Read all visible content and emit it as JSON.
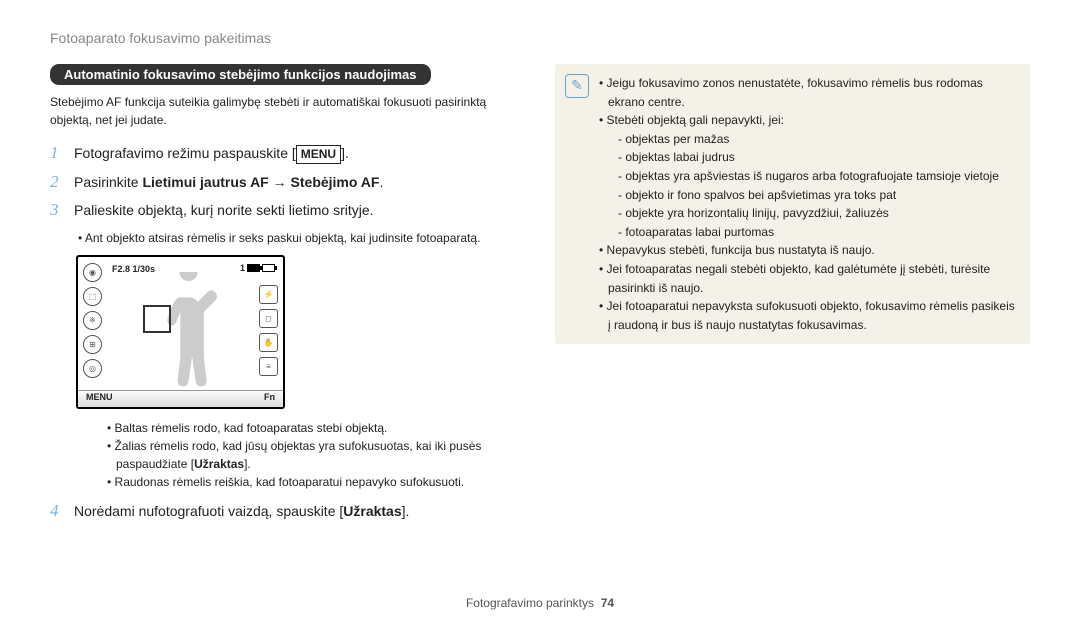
{
  "header": "Fotoaparato fokusavimo pakeitimas",
  "section_title": "Automatinio fokusavimo stebėjimo funkcijos naudojimas",
  "intro": "Stebėjimo AF funkcija suteikia galimybę stebėti ir automatiškai fokusuoti pasirinktą objektą, net jei judate.",
  "steps": {
    "s1": {
      "num": "1",
      "pre": "Fotografavimo režimu paspauskite [",
      "menu": "MENU",
      "post": "]."
    },
    "s2": {
      "num": "2",
      "pre": "Pasirinkite ",
      "b1": "Lietimui jautrus AF",
      "arrow": " → ",
      "b2": "Stebėjimo AF",
      "post": "."
    },
    "s3": {
      "num": "3",
      "text": "Palieskite objektą, kurį norite sekti lietimo srityje.",
      "sub": "Ant objekto atsiras rėmelis ir seks paskui objektą, kai judinsite fotoaparatą."
    },
    "s4": {
      "num": "4",
      "pre": "Norėdami nufotografuoti vaizdą, spauskite [",
      "b": "Užraktas",
      "post": "]."
    }
  },
  "screen": {
    "exposure": "F2.8 1/30s",
    "count": "1",
    "menu": "MENU",
    "fn": "Fn"
  },
  "bullets": [
    "Baltas rėmelis rodo, kad fotoaparatas stebi objektą.",
    "Žalias rėmelis rodo, kad jūsų objektas yra sufokusuotas, kai iki pusės paspaudžiate [",
    "Užraktas",
    "].",
    "Raudonas rėmelis reiškia, kad fotoaparatui nepavyko sufokusuoti."
  ],
  "note": {
    "n1": "Jeigu fokusavimo zonos nenustatėte, fokusavimo rėmelis bus rodomas ekrano centre.",
    "n2": "Stebėti objektą gali nepavykti, jei:",
    "d1": "objektas per mažas",
    "d2": "objektas labai judrus",
    "d3": "objektas yra apšviestas iš nugaros arba fotografuojate tamsioje vietoje",
    "d4": "objekto ir fono spalvos bei apšvietimas yra toks pat",
    "d5": "objekte yra horizontalių linijų, pavyzdžiui, žaliuzės",
    "d6": "fotoaparatas labai purtomas",
    "n3": "Nepavykus stebėti, funkcija bus nustatyta iš naujo.",
    "n4": "Jei fotoaparatas negali stebėti objekto, kad galėtumėte jį stebėti, turėsite pasirinkti iš naujo.",
    "n5": "Jei fotoaparatui nepavyksta sufokusuoti objekto, fokusavimo rėmelis pasikeis į raudoną ir bus iš naujo nustatytas fokusavimas."
  },
  "footer": {
    "label": "Fotografavimo parinktys",
    "page": "74"
  }
}
